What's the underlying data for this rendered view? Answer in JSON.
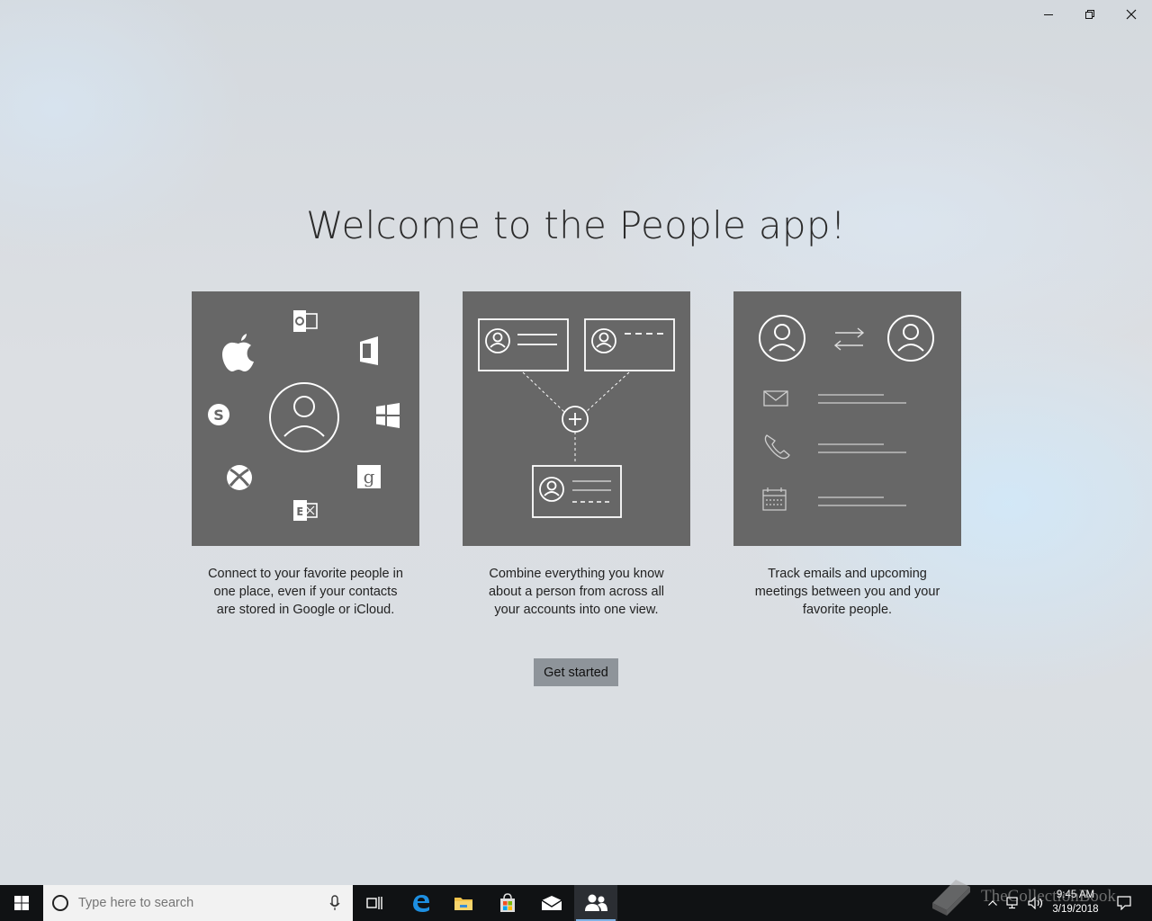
{
  "window": {
    "controls": {
      "minimize_icon": "minimize-icon",
      "restore_icon": "restore-icon",
      "close_icon": "close-icon"
    }
  },
  "main": {
    "title": "Welcome to the People app!",
    "cards": [
      {
        "caption_lines": [
          "Connect to your favorite people in",
          "one place, even if your contacts",
          "are stored in Google or iCloud."
        ]
      },
      {
        "caption_lines": [
          "Combine everything you know",
          "about a person from across all",
          "your accounts into one view."
        ]
      },
      {
        "caption_lines": [
          "Track emails and upcoming",
          "meetings between you and your",
          "favorite people."
        ]
      }
    ],
    "get_started_label": "Get started"
  },
  "taskbar": {
    "search_placeholder": "Type here to search",
    "apps": [
      "task-view-icon",
      "edge-icon",
      "file-explorer-icon",
      "store-icon",
      "mail-icon",
      "people-icon"
    ],
    "active_app": "people-icon",
    "clock": {
      "time": "9:45 AM",
      "date": "3/19/2018"
    },
    "watermark": "TheCollectionBook"
  },
  "colors": {
    "card": "#676767",
    "button": "#8e949a",
    "taskbar": "#101214",
    "active_indicator": "#7fb2e5"
  }
}
